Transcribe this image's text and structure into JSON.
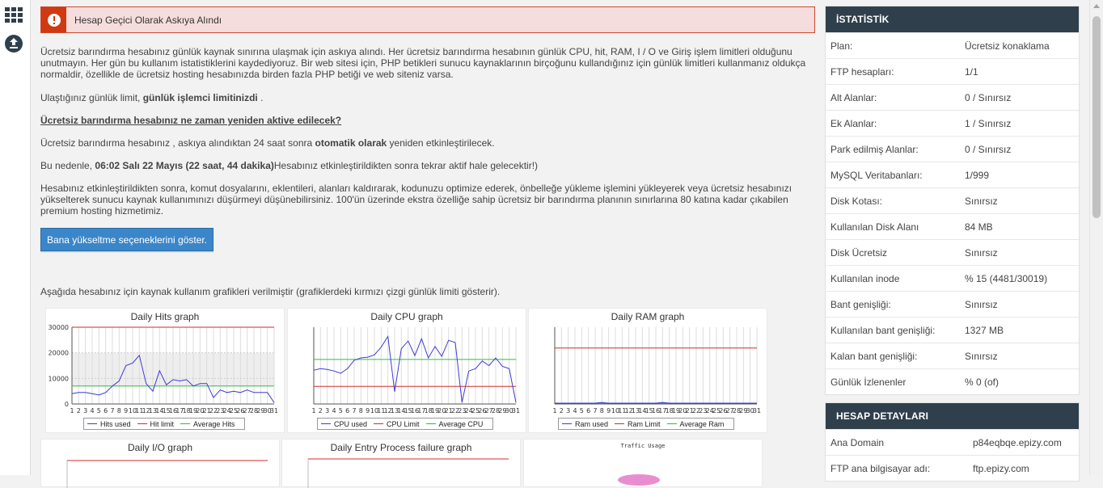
{
  "alert": {
    "title": "Hesap Geçici Olarak Askıya Alındı",
    "color": "#cf3a12"
  },
  "content": {
    "p1": "Ücretsiz barındırma hesabınız günlük kaynak sınırına ulaşmak için askıya alındı. Her ücretsiz barındırma hesabının günlük CPU, hit, RAM, I / O ve Giriş işlem limitleri olduğunu unutmayın. Her gün bu kullanım istatistiklerini kaydediyoruz. Bir web sitesi için, PHP betikleri sunucu kaynaklarının birçoğunu kullandığınız için günlük limitleri kullanmanız oldukça normaldir, özellikle de ücretsiz hosting hesabınızda birden fazla PHP betiği ve web siteniz varsa.",
    "p2_prefix": "Ulaştığınız günlük limit, ",
    "p2_bold": "günlük işlemci limitinizdi",
    "p2_suffix": " .",
    "heading": "Ücretsiz barındırma hesabınız ne zaman yeniden aktive edilecek?",
    "p3_prefix": "Ücretsiz barındırma hesabınız , askıya alındıktan 24 saat sonra ",
    "p3_bold": "otomatik olarak",
    "p3_suffix": " yeniden etkinleştirilecek.",
    "p4_prefix": "Bu nedenle, ",
    "p4_bold": "06:02 Salı 22 Mayıs (22 saat, 44 dakika)",
    "p4_suffix": "Hesabınız etkinleştirildikten sonra tekrar aktif hale gelecektir!)",
    "p5": "Hesabınız etkinleştirildikten sonra, komut dosyalarını, eklentileri, alanları kaldırarak, kodunuzu optimize ederek, önbelleğe yükleme işlemini yükleyerek veya ücretsiz hesabınızı yükselterek sunucu kaynak kullanımınızı düşürmeyi düşünebilirsiniz. 100'ün üzerinde ekstra özelliğe sahip ücretsiz bir barındırma planının sınırlarına 80 katına kadar çıkabilen premium hosting hizmetimiz.",
    "upgrade_button": "Bana yükseltme seçeneklerini göster.",
    "graphs_intro": "Aşağıda hesabınız için kaynak kullanım grafikleri verilmiştir (grafiklerdeki kırmızı çizgi günlük limiti gösterir)."
  },
  "chart_data": [
    {
      "type": "line",
      "title": "Daily Hits graph",
      "yticks": [
        "30000",
        "20000",
        "10000",
        "0"
      ],
      "ylim": [
        0,
        30000
      ],
      "x": [
        1,
        2,
        3,
        4,
        5,
        6,
        7,
        8,
        9,
        10,
        11,
        12,
        13,
        14,
        15,
        16,
        17,
        18,
        19,
        20,
        21,
        22,
        23,
        24,
        25,
        26,
        27,
        28,
        29,
        30,
        31
      ],
      "series": [
        {
          "name": "Hits used",
          "color": "#3b3bd6",
          "values": [
            4000,
            4500,
            4500,
            4000,
            3500,
            4500,
            7000,
            9000,
            15000,
            16000,
            19000,
            8000,
            5000,
            13000,
            7500,
            9500,
            9000,
            9500,
            7000,
            8000,
            8000,
            2500,
            5500,
            4500,
            5000,
            4500,
            5500,
            4500,
            4500,
            4500,
            500
          ]
        },
        {
          "name": "Hit limit",
          "color": "#d62b2b",
          "values": [
            30000,
            30000,
            30000,
            30000,
            30000,
            30000,
            30000,
            30000,
            30000,
            30000,
            30000,
            30000,
            30000,
            30000,
            30000,
            30000,
            30000,
            30000,
            30000,
            30000,
            30000,
            30000,
            30000,
            30000,
            30000,
            30000,
            30000,
            30000,
            30000,
            30000,
            30000
          ]
        },
        {
          "name": "Average Hits",
          "color": "#2fbf3b",
          "values": [
            7000,
            7000,
            7000,
            7000,
            7000,
            7000,
            7000,
            7000,
            7000,
            7000,
            7000,
            7000,
            7000,
            7000,
            7000,
            7000,
            7000,
            7000,
            7000,
            7000,
            7000,
            7000,
            7000,
            7000,
            7000,
            7000,
            7000,
            7000,
            7000,
            7000,
            7000
          ]
        }
      ]
    },
    {
      "type": "line",
      "title": "Daily CPU graph",
      "ylim": [
        0,
        100
      ],
      "x": [
        1,
        2,
        3,
        4,
        5,
        6,
        7,
        8,
        9,
        10,
        11,
        12,
        13,
        14,
        15,
        16,
        17,
        18,
        19,
        20,
        21,
        22,
        23,
        24,
        25,
        26,
        27,
        28,
        29,
        30,
        31
      ],
      "series": [
        {
          "name": "CPU used",
          "color": "#3b3bd6",
          "values": [
            44,
            46,
            45,
            43,
            40,
            46,
            57,
            60,
            61,
            64,
            74,
            88,
            16,
            72,
            82,
            63,
            85,
            60,
            75,
            62,
            83,
            80,
            2,
            43,
            46,
            56,
            50,
            60,
            49,
            46,
            2
          ]
        },
        {
          "name": "CPU Limit",
          "color": "#d62b2b",
          "values": [
            23,
            23,
            23,
            23,
            23,
            23,
            23,
            23,
            23,
            23,
            23,
            23,
            23,
            23,
            23,
            23,
            23,
            23,
            23,
            23,
            23,
            23,
            23,
            23,
            23,
            23,
            23,
            23,
            23,
            23,
            23
          ]
        },
        {
          "name": "Average CPU",
          "color": "#2fbf3b",
          "values": [
            58,
            58,
            58,
            58,
            58,
            58,
            58,
            58,
            58,
            58,
            58,
            58,
            58,
            58,
            58,
            58,
            58,
            58,
            58,
            58,
            58,
            58,
            58,
            58,
            58,
            58,
            58,
            58,
            58,
            58,
            58
          ]
        }
      ]
    },
    {
      "type": "line",
      "title": "Daily RAM graph",
      "ylim": [
        0,
        100
      ],
      "x": [
        1,
        2,
        3,
        4,
        5,
        6,
        7,
        8,
        9,
        10,
        11,
        12,
        13,
        14,
        15,
        16,
        17,
        18,
        19,
        20,
        21,
        22,
        23,
        24,
        25,
        26,
        27,
        28,
        29,
        30,
        31
      ],
      "series": [
        {
          "name": "Ram used",
          "color": "#3b3bd6",
          "values": [
            1,
            1,
            1,
            1,
            1,
            1,
            1,
            2,
            1,
            1,
            1,
            1,
            1,
            1,
            1,
            1,
            2,
            1,
            1,
            1,
            1,
            1,
            1,
            1,
            1,
            1,
            1,
            1,
            1,
            1,
            1
          ]
        },
        {
          "name": "Ram Limit",
          "color": "#d62b2b",
          "values": [
            73,
            73,
            73,
            73,
            73,
            73,
            73,
            73,
            73,
            73,
            73,
            73,
            73,
            73,
            73,
            73,
            73,
            73,
            73,
            73,
            73,
            73,
            73,
            73,
            73,
            73,
            73,
            73,
            73,
            73,
            73
          ]
        },
        {
          "name": "Average Ram",
          "color": "#2fbf3b",
          "values": [
            1,
            1,
            1,
            1,
            1,
            1,
            1,
            1,
            1,
            1,
            1,
            1,
            1,
            1,
            1,
            1,
            1,
            1,
            1,
            1,
            1,
            1,
            1,
            1,
            1,
            1,
            1,
            1,
            1,
            1,
            1
          ]
        }
      ]
    },
    {
      "type": "line",
      "title": "Daily I/O graph"
    },
    {
      "type": "line",
      "title": "Daily Entry Process failure graph"
    },
    {
      "type": "pie",
      "title": "Traffic Usage"
    }
  ],
  "stats": {
    "title": "İSTATİSTİK",
    "rows": [
      {
        "label": "Plan:",
        "value": "Ücretsiz konaklama"
      },
      {
        "label": "FTP hesapları:",
        "value": "1/1"
      },
      {
        "label": "Alt Alanlar:",
        "value": "0 / Sınırsız"
      },
      {
        "label": "Ek Alanlar:",
        "value": "1 / Sınırsız"
      },
      {
        "label": "Park edilmiş Alanlar:",
        "value": "0 / Sınırsız"
      },
      {
        "label": "MySQL Veritabanları:",
        "value": "1/999"
      },
      {
        "label": "Disk Kotası:",
        "value": "Sınırsız"
      },
      {
        "label": "Kullanılan Disk Alanı",
        "value": "84 MB"
      },
      {
        "label": "Disk Ücretsiz",
        "value": "Sınırsız"
      },
      {
        "label": "Kullanılan inode",
        "value": "% 15 (4481/30019)"
      },
      {
        "label": "Bant genişliği:",
        "value": "Sınırsız"
      },
      {
        "label": "Kullanılan bant genişliği:",
        "value": "1327 MB"
      },
      {
        "label": "Kalan bant genişliği:",
        "value": "Sınırsız"
      },
      {
        "label": "Günlük İzlenenler",
        "value": "% 0 (of)"
      }
    ]
  },
  "account": {
    "title": "HESAP DETAYLARI",
    "rows": [
      {
        "label": "Ana Domain",
        "value": "p84eqbqe.epizy.com"
      },
      {
        "label": "FTP ana bilgisayar adı:",
        "value": "ftp.epizy.com"
      }
    ]
  }
}
